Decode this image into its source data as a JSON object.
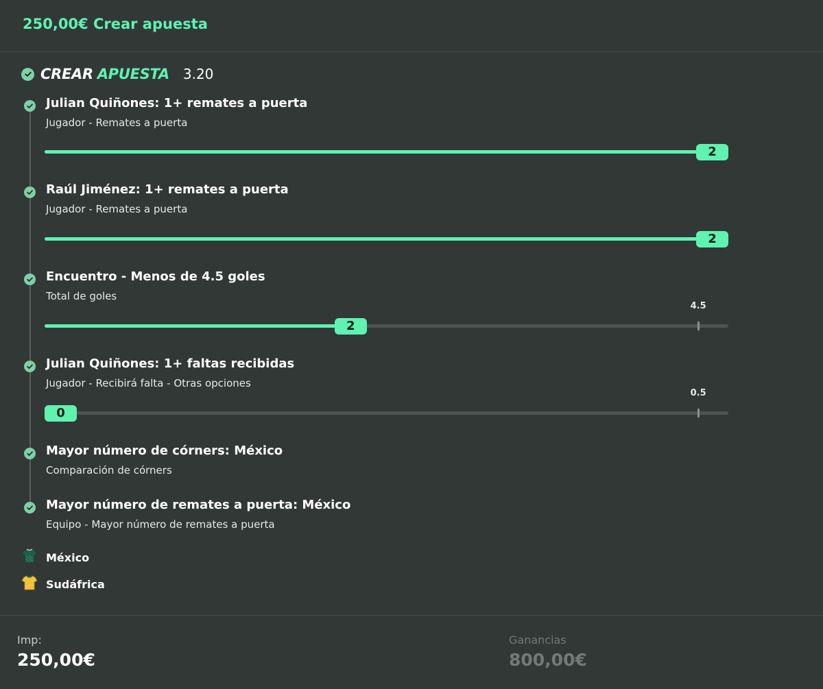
{
  "header": {
    "title": "250,00€ Crear apuesta"
  },
  "builder": {
    "brand_part1": "CREAR",
    "brand_part2": "APUESTA",
    "odds": "3.20"
  },
  "legs": [
    {
      "title": "Julian Quiñones: 1+ remates a puerta",
      "subtitle": "Jugador - Remates a puerta",
      "slider": {
        "value": "2",
        "fill_fraction": 1.0
      }
    },
    {
      "title": "Raúl Jiménez: 1+ remates a puerta",
      "subtitle": "Jugador - Remates a puerta",
      "slider": {
        "value": "2",
        "fill_fraction": 1.0
      }
    },
    {
      "title": "Encuentro - Menos de 4.5 goles",
      "subtitle": "Total de goles",
      "slider": {
        "value": "2",
        "fill_fraction": 0.445,
        "threshold_label": "4.5",
        "threshold_fraction": 0.956
      }
    },
    {
      "title": "Julian Quiñones: 1+ faltas recibidas",
      "subtitle": "Jugador - Recibirá falta - Otras opciones",
      "slider": {
        "value": "0",
        "fill_fraction": 0.0,
        "threshold_label": "0.5",
        "threshold_fraction": 0.956
      }
    },
    {
      "title": "Mayor número de córners: México",
      "subtitle": "Comparación de córners"
    },
    {
      "title": "Mayor número de remates a puerta: México",
      "subtitle": "Equipo - Mayor número de remates a puerta"
    }
  ],
  "teams": [
    {
      "name": "México",
      "icon": "jersey-icon",
      "color": "#1f5e47"
    },
    {
      "name": "Sudáfrica",
      "icon": "jersey-icon",
      "color": "#f2c23a"
    }
  ],
  "footer": {
    "stake_label": "Imp:",
    "stake_value": "250,00€",
    "winnings_label": "Ganancias",
    "winnings_value": "800,00€"
  },
  "colors": {
    "accent": "#5ff2b1",
    "background": "#323836",
    "check": "#7fcfa8",
    "muted": "#737977"
  }
}
